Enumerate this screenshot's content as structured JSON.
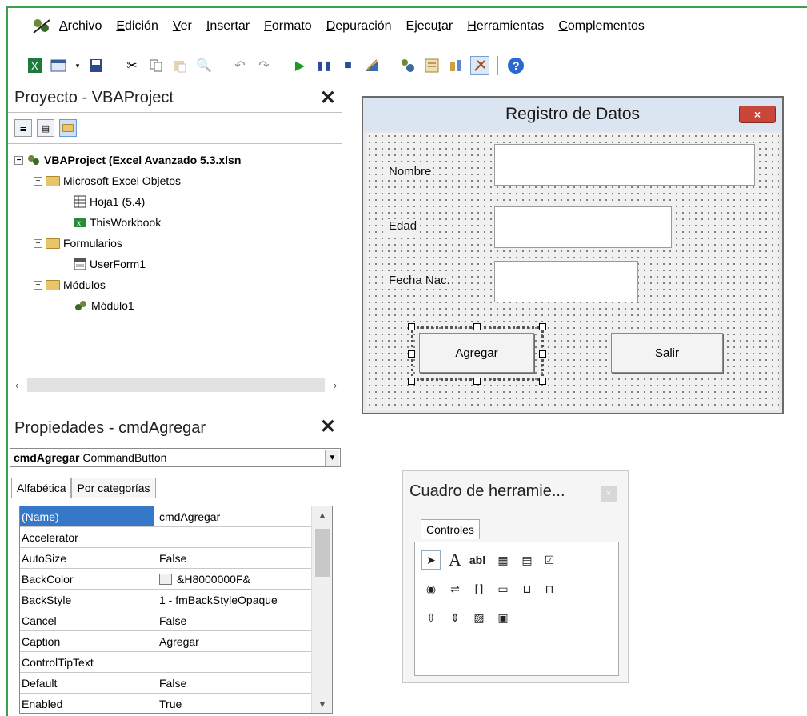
{
  "menubar": {
    "icon": "vba-app-icon",
    "items": [
      {
        "label": "Archivo",
        "key": "A"
      },
      {
        "label": "Edición",
        "key": "E"
      },
      {
        "label": "Ver",
        "key": "V"
      },
      {
        "label": "Insertar",
        "key": "I"
      },
      {
        "label": "Formato",
        "key": "F"
      },
      {
        "label": "Depuración",
        "key": "D"
      },
      {
        "label": "Ejecutar",
        "key": "t"
      },
      {
        "label": "Herramientas",
        "key": "H"
      },
      {
        "label": "Complementos",
        "key": "C"
      }
    ]
  },
  "toolbar": {
    "buttons": [
      "excel-view-icon",
      "insert-userform-icon",
      "save-icon",
      "cut-icon",
      "copy-icon",
      "paste-icon",
      "find-icon",
      "undo-icon",
      "redo-icon",
      "run-icon",
      "pause-icon",
      "stop-icon",
      "design-mode-icon",
      "project-explorer-icon",
      "properties-icon",
      "object-browser-icon",
      "toolbox-icon",
      "help-icon"
    ]
  },
  "project": {
    "title": "Proyecto - VBAProject",
    "tree": {
      "root": "VBAProject (Excel Avanzado 5.3.xlsn",
      "excel_objects": "Microsoft Excel Objetos",
      "sheet": "Hoja1 (5.4)",
      "workbook": "ThisWorkbook",
      "forms": "Formularios",
      "userform": "UserForm1",
      "modules": "Módulos",
      "module": "Módulo1"
    }
  },
  "properties": {
    "title": "Propiedades - cmdAgregar",
    "object_name": "cmdAgregar",
    "object_type": "CommandButton",
    "tabs": [
      "Alfabética",
      "Por categorías"
    ],
    "rows": [
      {
        "name": "(Name)",
        "value": "cmdAgregar"
      },
      {
        "name": "Accelerator",
        "value": ""
      },
      {
        "name": "AutoSize",
        "value": "False"
      },
      {
        "name": "BackColor",
        "value": "&H8000000F&"
      },
      {
        "name": "BackStyle",
        "value": "1 - fmBackStyleOpaque"
      },
      {
        "name": "Cancel",
        "value": "False"
      },
      {
        "name": "Caption",
        "value": "Agregar"
      },
      {
        "name": "ControlTipText",
        "value": ""
      },
      {
        "name": "Default",
        "value": "False"
      },
      {
        "name": "Enabled",
        "value": "True"
      }
    ]
  },
  "userform": {
    "title": "Registro de Datos",
    "close": "×",
    "labels": {
      "nombre": "Nombre",
      "edad": "Edad",
      "fecha": "Fecha Nac."
    },
    "buttons": {
      "agregar": "Agregar",
      "salir": "Salir"
    }
  },
  "toolbox": {
    "title": "Cuadro de herramie...",
    "close": "×",
    "tab": "Controles",
    "tools": [
      "select-objects-icon",
      "label-icon",
      "textbox-icon",
      "combobox-icon",
      "listbox-icon",
      "checkbox-icon",
      "optionbutton-icon",
      "togglebutton-icon",
      "frame-icon",
      "commandbutton-icon",
      "tabstrip-icon",
      "multipage-icon",
      "scrollbar-icon",
      "spinbutton-icon",
      "image-icon",
      "refedit-icon"
    ]
  }
}
